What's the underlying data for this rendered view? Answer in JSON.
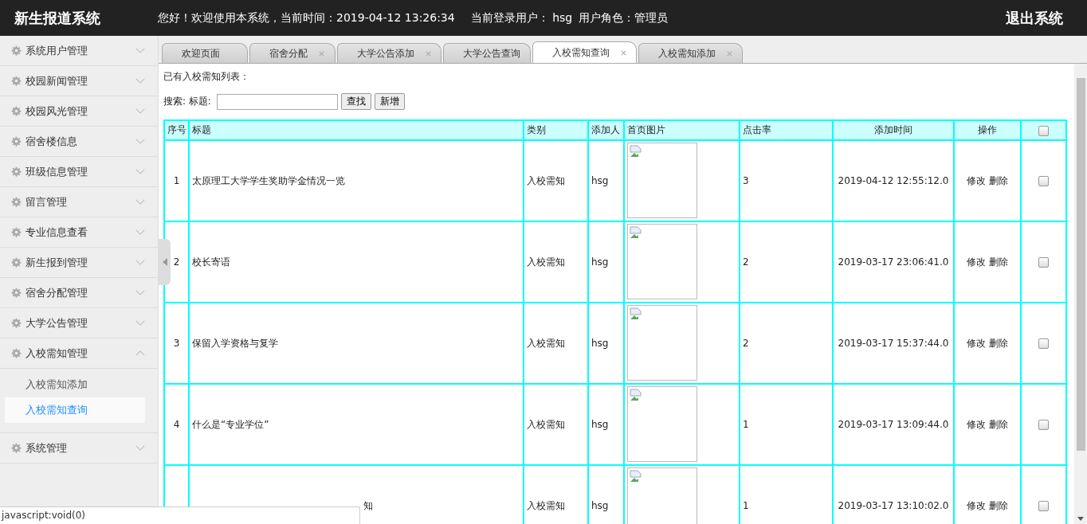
{
  "app_title": "新生报道系统",
  "header": {
    "greeting": "您好！欢迎使用本系统，当前时间：2019-04-12 13:26:34",
    "login": "当前登录用户： hsg",
    "role": "用户角色：管理员"
  },
  "logout": "退出系统",
  "sidebar": {
    "items": [
      {
        "label": "系统用户管理",
        "expanded": false
      },
      {
        "label": "校园新闻管理",
        "expanded": false
      },
      {
        "label": "校园风光管理",
        "expanded": false
      },
      {
        "label": "宿舍楼信息",
        "expanded": false
      },
      {
        "label": "班级信息管理",
        "expanded": false
      },
      {
        "label": "留言管理",
        "expanded": false
      },
      {
        "label": "专业信息查看",
        "expanded": false
      },
      {
        "label": "新生报到管理",
        "expanded": false
      },
      {
        "label": "宿舍分配管理",
        "expanded": false
      },
      {
        "label": "大学公告管理",
        "expanded": false
      },
      {
        "label": "入校需知管理",
        "expanded": true,
        "children": [
          {
            "label": "入校需知添加",
            "selected": false
          },
          {
            "label": "入校需知查询",
            "selected": true
          }
        ]
      },
      {
        "label": "系统管理",
        "expanded": false
      }
    ]
  },
  "tabs": [
    {
      "label": "欢迎页面",
      "selected": false,
      "closable": false
    },
    {
      "label": "宿舍分配",
      "selected": false,
      "closable": true
    },
    {
      "label": "大学公告添加",
      "selected": false,
      "closable": true
    },
    {
      "label": "大学公告查询",
      "selected": false,
      "closable": false
    },
    {
      "label": "入校需知查询",
      "selected": true,
      "closable": true
    },
    {
      "label": "入校需知添加",
      "selected": false,
      "closable": true
    }
  ],
  "page": {
    "list_title": "已有入校需知列表：",
    "search_label": "搜索: 标题:",
    "buttons": [
      "查找",
      "新增"
    ]
  },
  "table": {
    "columns": [
      "序号",
      "标题",
      "类别",
      "添加人",
      "首页图片",
      "点击率",
      "添加时间",
      "操作"
    ],
    "select_all": {
      "checked": false
    },
    "rows": [
      {
        "index": "1",
        "title": "太原理工大学学生奖助学金情况一览",
        "category": "入校需知",
        "author": "hsg",
        "clicks": "3",
        "added": "2019-04-12 12:55:12.0",
        "actions": [
          "修改",
          "删除"
        ],
        "checked": false
      },
      {
        "index": "2",
        "title": "校长寄语",
        "category": "入校需知",
        "author": "hsg",
        "clicks": "2",
        "added": "2019-03-17 23:06:41.0",
        "actions": [
          "修改",
          "删除"
        ],
        "checked": false
      },
      {
        "index": "3",
        "title": "保留入学资格与复学",
        "category": "入校需知",
        "author": "hsg",
        "clicks": "2",
        "added": "2019-03-17 15:37:44.0",
        "actions": [
          "修改",
          "删除"
        ],
        "checked": false
      },
      {
        "index": "4",
        "title": "什么是“专业学位”",
        "category": "入校需知",
        "author": "hsg",
        "clicks": "1",
        "added": "2019-03-17 13:09:44.0",
        "actions": [
          "修改",
          "删除"
        ],
        "checked": false
      },
      {
        "title": "知",
        "partly_covered": true,
        "category": "入校需知",
        "author": "hsg",
        "clicks": "1",
        "added": "2019-03-17 13:10:02.0",
        "actions": [
          "修改",
          "删除"
        ],
        "checked": false
      }
    ]
  },
  "status_bar": "javascript:void(0)"
}
